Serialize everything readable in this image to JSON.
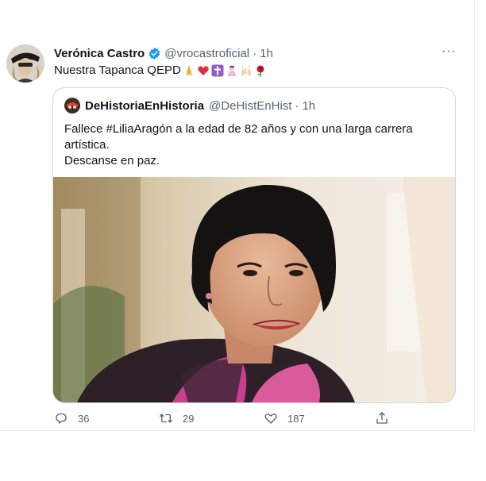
{
  "tweet": {
    "author_name": "Verónica Castro",
    "author_handle": "@vrocastroficial",
    "separator": "·",
    "time": "1h",
    "more_label": "···",
    "text": "Nuestra Tapanca QEPD",
    "emojis": [
      "folded-hands",
      "red-heart",
      "latin-cross",
      "person-praying",
      "raising-hands",
      "rose"
    ]
  },
  "quote": {
    "author_name": "DeHistoriaEnHistoria",
    "author_handle": "@DeHistEnHist",
    "separator": "·",
    "time": "1h",
    "line1": "Fallece #LiliaAragón a la edad de 82 años y con una larga carrera artística.",
    "line2": "Descanse en paz."
  },
  "actions": {
    "reply_count": "36",
    "retweet_count": "29",
    "like_count": "187"
  },
  "colors": {
    "text": "#0f1419",
    "secondary": "#536471",
    "verified": "#1d9bf0",
    "border": "#cfd9de"
  }
}
